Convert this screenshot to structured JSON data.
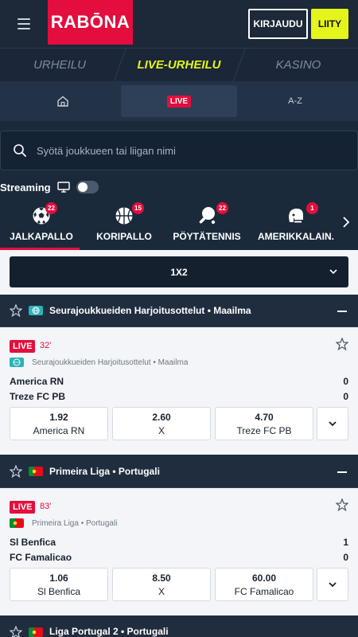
{
  "header": {
    "logo": "RABŌNA",
    "login_label": "KIRJAUDU",
    "join_label": "LIITY",
    "brand_color": "#e30e3d",
    "join_color": "#e3f51a"
  },
  "sections": [
    {
      "label": "URHEILU",
      "active": false
    },
    {
      "label": "LIVE-URHEILU",
      "active": true
    },
    {
      "label": "KASINO",
      "active": false
    }
  ],
  "subnav": {
    "home_icon": "home-icon",
    "live_label": "LIVE",
    "az_label": "A-Z"
  },
  "search": {
    "placeholder": "Syötä joukkueen tai liigan nimi"
  },
  "streaming": {
    "label": "Streaming",
    "enabled": false
  },
  "sports": [
    {
      "label": "JALKAPALLO",
      "count": "22",
      "icon": "football-icon",
      "active": true
    },
    {
      "label": "KORIPALLO",
      "count": "15",
      "icon": "basketball-icon",
      "active": false
    },
    {
      "label": "PÖYTÄTENNIS",
      "count": "22",
      "icon": "table-tennis-icon",
      "active": false
    },
    {
      "label": "AMERIKKALAIN.",
      "count": "1",
      "icon": "american-football-icon",
      "active": false
    }
  ],
  "market": {
    "selected": "1X2"
  },
  "leagues": [
    {
      "title": "Seurajoukkueiden Harjoitusottelut • Maailma",
      "flag": "globe",
      "event": {
        "live_label": "LIVE",
        "minute": "32'",
        "meta": "Seurajoukkueiden Harjoitusottelut • Maailma",
        "home": "America RN",
        "away": "Treze FC PB",
        "home_score": "0",
        "away_score": "0",
        "odds": [
          {
            "value": "1.92",
            "label": "America RN"
          },
          {
            "value": "2.60",
            "label": "X"
          },
          {
            "value": "4.70",
            "label": "Treze FC PB"
          }
        ]
      }
    },
    {
      "title": "Primeira Liga • Portugali",
      "flag": "portugal",
      "event": {
        "live_label": "LIVE",
        "minute": "83'",
        "meta": "Primeira Liga • Portugali",
        "home": "Sl Benfica",
        "away": "FC Famalicao",
        "home_score": "1",
        "away_score": "0",
        "odds": [
          {
            "value": "1.06",
            "label": "Sl Benfica"
          },
          {
            "value": "8.50",
            "label": "X"
          },
          {
            "value": "60.00",
            "label": "FC Famalicao"
          }
        ]
      }
    },
    {
      "title": "Liga Portugal 2 • Portugali",
      "flag": "portugal"
    }
  ]
}
